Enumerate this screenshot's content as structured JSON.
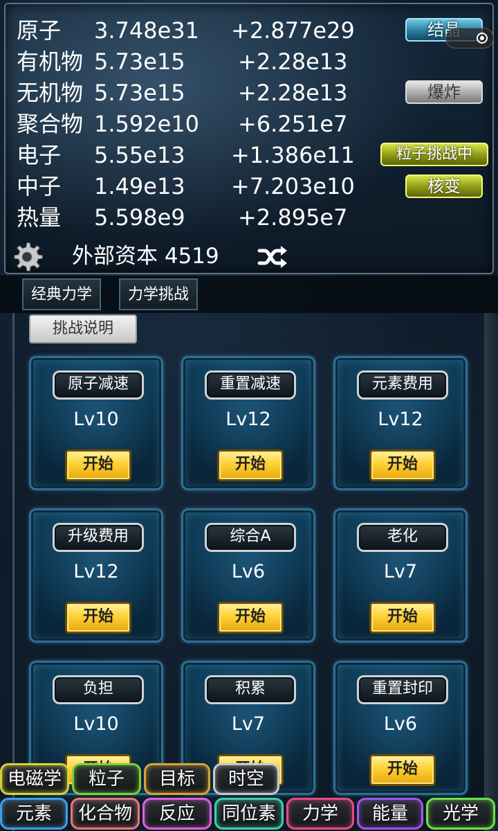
{
  "resources": [
    {
      "name": "原子",
      "value": "3.748e31",
      "rate": "+2.877e29"
    },
    {
      "name": "有机物",
      "value": "5.73e15",
      "rate": "+2.28e13"
    },
    {
      "name": "无机物",
      "value": "5.73e15",
      "rate": "+2.28e13"
    },
    {
      "name": "聚合物",
      "value": "1.592e10",
      "rate": "+6.251e7"
    },
    {
      "name": "电子",
      "value": "5.55e13",
      "rate": "+1.386e11"
    },
    {
      "name": "中子",
      "value": "1.49e13",
      "rate": "+7.203e10"
    },
    {
      "name": "热量",
      "value": "5.598e9",
      "rate": "+2.895e7"
    }
  ],
  "side_buttons": {
    "crystal": "结晶",
    "explode": "爆炸",
    "particle_challenge": "粒子挑战中",
    "fission": "核变"
  },
  "capital": "外部资本 4519",
  "tabs": {
    "classic": "经典力学",
    "challenge": "力学挑战"
  },
  "help_label": "挑战说明",
  "start_label": "开始",
  "challenges": [
    {
      "name": "原子减速",
      "level": "Lv10"
    },
    {
      "name": "重置减速",
      "level": "Lv12"
    },
    {
      "name": "元素费用",
      "level": "Lv12"
    },
    {
      "name": "升级费用",
      "level": "Lv12"
    },
    {
      "name": "综合A",
      "level": "Lv6"
    },
    {
      "name": "老化",
      "level": "Lv7"
    },
    {
      "name": "负担",
      "level": "Lv10"
    },
    {
      "name": "积累",
      "level": "Lv7"
    },
    {
      "name": "重置封印",
      "level": "Lv6"
    }
  ],
  "nav_top": [
    "电磁学",
    "粒子",
    "目标",
    "时空"
  ],
  "nav_bottom": [
    "元素",
    "化合物",
    "反应",
    "同位素",
    "力学",
    "能量",
    "光学"
  ],
  "icons": {
    "settings": "gear-icon",
    "shuffle": "shuffle-icon",
    "toggle": "toggle-icon"
  }
}
